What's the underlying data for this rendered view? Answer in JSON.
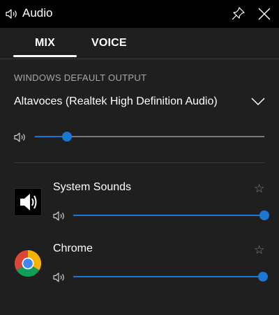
{
  "window": {
    "title": "Audio",
    "icons": {
      "title": "speaker-icon",
      "pin": "pin-icon",
      "close": "close-icon"
    }
  },
  "tabs": [
    {
      "label": "MIX",
      "active": true
    },
    {
      "label": "VOICE",
      "active": false
    }
  ],
  "output": {
    "section_label": "WINDOWS DEFAULT OUTPUT",
    "device": "Altavoces (Realtek High Definition Audio)",
    "volume_fraction": 0.14
  },
  "apps": [
    {
      "name": "System Sounds",
      "icon": "speaker-icon",
      "volume_fraction": 1.0,
      "favorite": false
    },
    {
      "name": "Chrome",
      "icon": "chrome-icon",
      "volume_fraction": 1.0,
      "favorite": false
    }
  ],
  "colors": {
    "accent": "#1a78d4",
    "titlebar_bg": "#000000",
    "panel_bg": "#1f1f1f",
    "secondary_text": "#a8a8a8"
  }
}
